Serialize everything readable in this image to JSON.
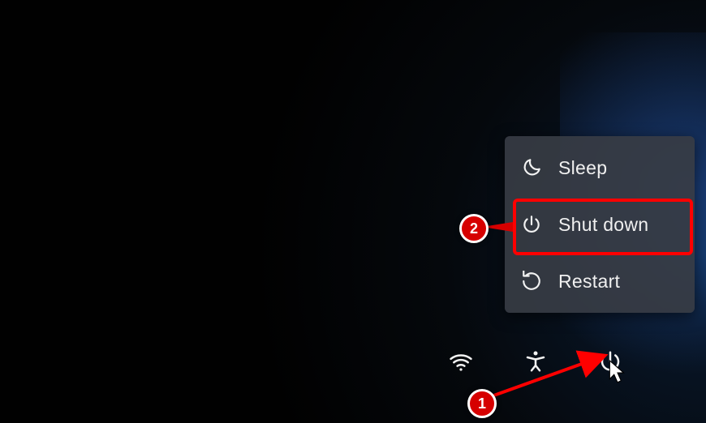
{
  "power_menu": {
    "items": [
      {
        "icon": "moon",
        "label": "Sleep"
      },
      {
        "icon": "power",
        "label": "Shut down"
      },
      {
        "icon": "restart",
        "label": "Restart"
      }
    ]
  },
  "bottom_bar": {
    "items": [
      {
        "icon": "wifi",
        "name": "network-button"
      },
      {
        "icon": "accessibility",
        "name": "accessibility-button"
      },
      {
        "icon": "power",
        "name": "power-button"
      }
    ]
  },
  "annotations": {
    "step1": "1",
    "step2": "2"
  },
  "colors": {
    "annotation": "#d60000",
    "highlight": "#ff0000",
    "menu_bg": "rgba(55,60,68,0.92)",
    "text": "#f0f0f0"
  }
}
